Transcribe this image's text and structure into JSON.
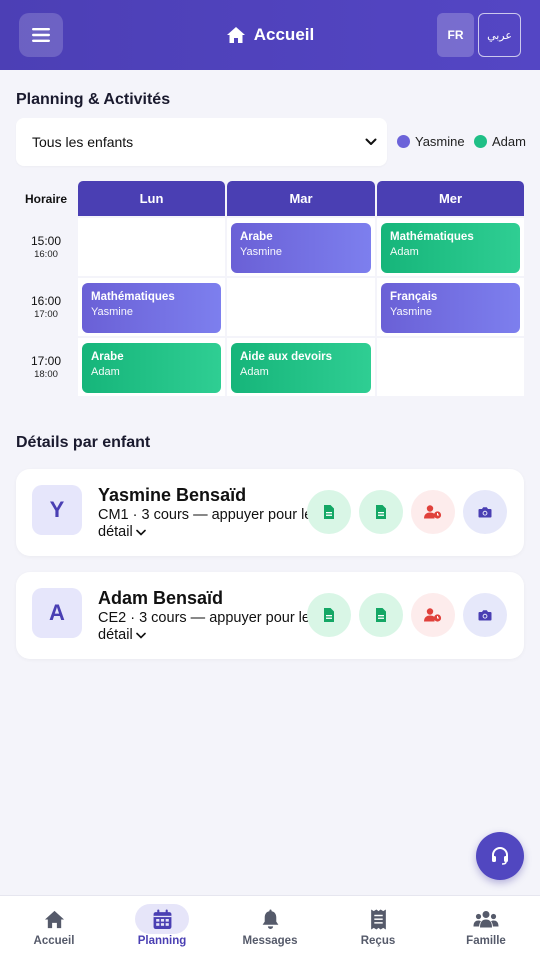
{
  "header": {
    "title": "Accueil",
    "lang_fr": "FR",
    "lang_ar": "عربي"
  },
  "planning": {
    "title": "Planning & Activités",
    "filter_value": "Tous les enfants",
    "legend": [
      {
        "name": "Yasmine",
        "color": "#6c63d9"
      },
      {
        "name": "Adam",
        "color": "#1fbf86"
      }
    ],
    "horaire_label": "Horaire",
    "days": [
      "Lun",
      "Mar",
      "Mer"
    ],
    "slots": [
      {
        "start": "15:00",
        "end": "16:00"
      },
      {
        "start": "16:00",
        "end": "17:00"
      },
      {
        "start": "17:00",
        "end": "18:00"
      }
    ],
    "events": [
      {
        "slot": 0,
        "day": 1,
        "title": "Arabe",
        "child": "Yasmine",
        "color": "purple"
      },
      {
        "slot": 0,
        "day": 2,
        "title": "Mathématiques",
        "child": "Adam",
        "color": "green"
      },
      {
        "slot": 1,
        "day": 0,
        "title": "Mathématiques",
        "child": "Yasmine",
        "color": "purple"
      },
      {
        "slot": 1,
        "day": 2,
        "title": "Français",
        "child": "Yasmine",
        "color": "purple"
      },
      {
        "slot": 2,
        "day": 0,
        "title": "Arabe",
        "child": "Adam",
        "color": "green"
      },
      {
        "slot": 2,
        "day": 1,
        "title": "Aide aux devoirs",
        "child": "Adam",
        "color": "green"
      }
    ]
  },
  "details": {
    "title": "Détails par enfant",
    "children": [
      {
        "initial": "Y",
        "name": "Yasmine Bensaïd",
        "summary": "CM1 · 3 cours — appuyer pour le détail"
      },
      {
        "initial": "A",
        "name": "Adam Bensaïd",
        "summary": "CE2 · 3 cours — appuyer pour le détail"
      }
    ]
  },
  "nav": {
    "items": [
      {
        "label": "Accueil",
        "icon": "home-icon"
      },
      {
        "label": "Planning",
        "icon": "calendar-icon",
        "active": true
      },
      {
        "label": "Messages",
        "icon": "bell-icon"
      },
      {
        "label": "Reçus",
        "icon": "receipt-icon"
      },
      {
        "label": "Famille",
        "icon": "users-icon"
      }
    ]
  }
}
